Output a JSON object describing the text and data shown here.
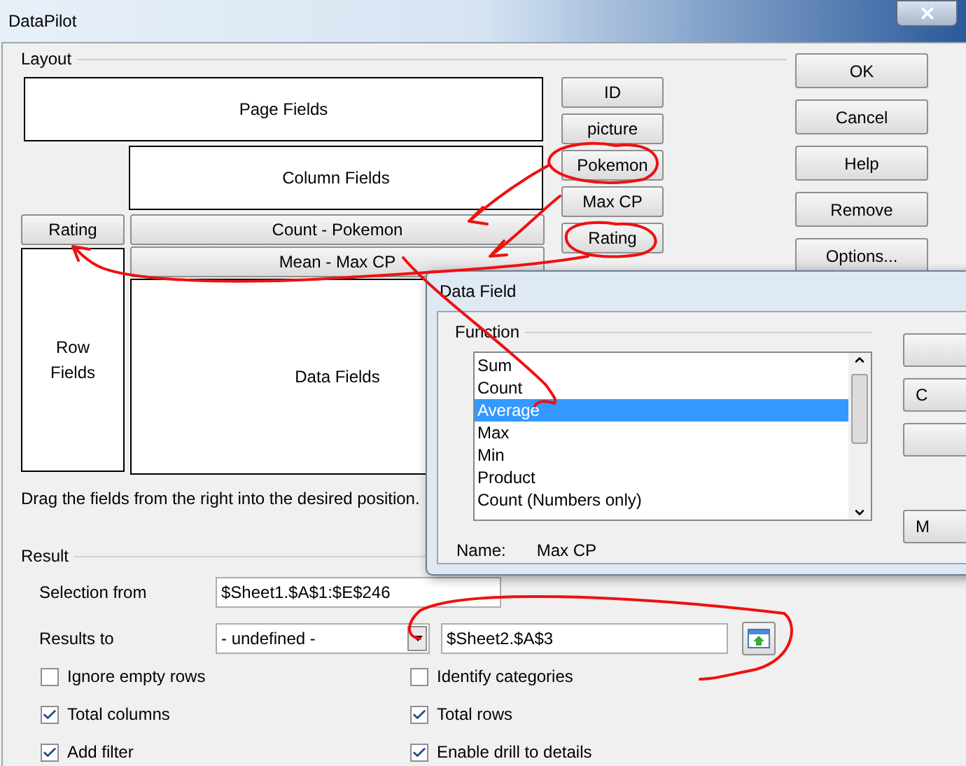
{
  "window": {
    "title": "DataPilot"
  },
  "layout": {
    "label": "Layout",
    "page_fields": "Page Fields",
    "column_fields": "Column Fields",
    "row_fields": "Row Fields",
    "data_fields": "Data Fields",
    "row_items": [
      "Rating"
    ],
    "data_items": [
      "Count - Pokemon",
      "Mean - Max CP"
    ],
    "available_fields": [
      "ID",
      "picture",
      "Pokemon",
      "Max CP",
      "Rating"
    ],
    "hint": "Drag the fields from the right into the desired position."
  },
  "buttons": [
    "OK",
    "Cancel",
    "Help",
    "Remove",
    "Options..."
  ],
  "result": {
    "label": "Result",
    "selection_from": {
      "label": "Selection from",
      "value": "$Sheet1.$A$1:$E$246"
    },
    "results_to": {
      "label": "Results to",
      "dropdown": "- undefined -",
      "value": "$Sheet2.$A$3"
    },
    "options": [
      {
        "label": "Ignore empty rows",
        "checked": false
      },
      {
        "label": "Identify categories",
        "checked": false
      },
      {
        "label": "Total columns",
        "checked": true
      },
      {
        "label": "Total rows",
        "checked": true
      },
      {
        "label": "Add filter",
        "checked": true
      },
      {
        "label": "Enable drill to details",
        "checked": true
      }
    ]
  },
  "data_field_dialog": {
    "title": "Data Field",
    "function_label": "Function",
    "functions": [
      {
        "label": "Sum",
        "selected": false
      },
      {
        "label": "Count",
        "selected": false
      },
      {
        "label": "Average",
        "selected": true
      },
      {
        "label": "Max",
        "selected": false
      },
      {
        "label": "Min",
        "selected": false
      },
      {
        "label": "Product",
        "selected": false
      },
      {
        "label": "Count (Numbers only)",
        "selected": false
      }
    ],
    "name_label": "Name:",
    "name_value": "Max CP",
    "buttons": [
      "C",
      "M"
    ]
  }
}
